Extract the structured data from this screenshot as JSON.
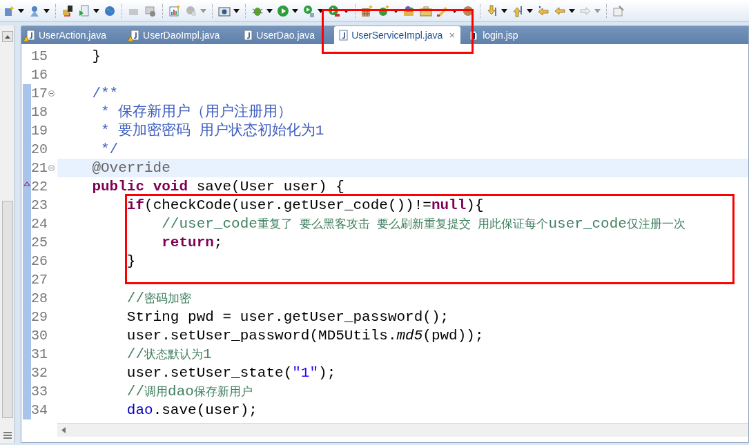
{
  "tabs": [
    {
      "label": "UserAction.java",
      "selected": false,
      "warning": true,
      "kind": "java"
    },
    {
      "label": "UserDaoImpl.java",
      "selected": false,
      "warning": true,
      "kind": "java"
    },
    {
      "label": "UserDao.java",
      "selected": false,
      "warning": false,
      "kind": "java"
    },
    {
      "label": "UserServiceImpl.java",
      "selected": true,
      "warning": false,
      "kind": "java",
      "close": "×"
    },
    {
      "label": "login.jsp",
      "selected": false,
      "warning": false,
      "kind": "jsp"
    }
  ],
  "editor": {
    "lines": [
      {
        "number": "15",
        "fold": false,
        "changed": false,
        "current": false,
        "override": false,
        "tokens": [
          {
            "kind": "plain",
            "text": "    }"
          }
        ]
      },
      {
        "number": "16",
        "fold": false,
        "changed": false,
        "current": false,
        "override": false
      },
      {
        "number": "17",
        "fold": true,
        "changed": true,
        "current": false,
        "override": false,
        "tokens": [
          {
            "kind": "doc",
            "text": "    /**"
          }
        ]
      },
      {
        "number": "18",
        "fold": false,
        "changed": true,
        "current": false,
        "override": false,
        "tokens": [
          {
            "kind": "doc",
            "text": "     * 保存新用户（用户注册用）"
          }
        ]
      },
      {
        "number": "19",
        "fold": false,
        "changed": true,
        "current": false,
        "override": false,
        "tokens": [
          {
            "kind": "doc",
            "text": "     * 要加密密码 用户状态初始化为1"
          }
        ]
      },
      {
        "number": "20",
        "fold": false,
        "changed": true,
        "current": false,
        "override": false,
        "tokens": [
          {
            "kind": "doc",
            "text": "     */"
          }
        ]
      },
      {
        "number": "21",
        "fold": true,
        "changed": true,
        "current": true,
        "override": false,
        "tokens": [
          {
            "kind": "annotation",
            "text": "    @Override"
          }
        ]
      },
      {
        "number": "22",
        "fold": false,
        "changed": true,
        "current": false,
        "override": true,
        "tokens": [
          {
            "kind": "keyword",
            "text": "    public"
          },
          {
            "kind": "keyword",
            "text": " void"
          },
          {
            "kind": "plain",
            "text": " save(User user) {"
          }
        ]
      },
      {
        "number": "23",
        "fold": false,
        "changed": true,
        "current": false,
        "override": false,
        "tokens": [
          {
            "kind": "keyword",
            "text": "        if"
          },
          {
            "kind": "plain",
            "text": "(checkCode(user.getUser_code())!="
          },
          {
            "kind": "keyword",
            "text": "null"
          },
          {
            "kind": "plain",
            "text": "){"
          }
        ]
      },
      {
        "number": "24",
        "fold": false,
        "changed": true,
        "current": false,
        "override": false,
        "tokens": [
          {
            "kind": "comment",
            "text": "            //user_code"
          },
          {
            "kind": "comment-cjk",
            "text": "重复了 要么黑客攻击 要么刷新重复提交 用此保证每个"
          },
          {
            "kind": "comment",
            "text": "user_code"
          },
          {
            "kind": "comment-cjk",
            "text": "仅注册一次"
          }
        ]
      },
      {
        "number": "25",
        "fold": false,
        "changed": true,
        "current": false,
        "override": false,
        "tokens": [
          {
            "kind": "keyword",
            "text": "            return"
          },
          {
            "kind": "plain",
            "text": ";"
          }
        ]
      },
      {
        "number": "26",
        "fold": false,
        "changed": true,
        "current": false,
        "override": false,
        "tokens": [
          {
            "kind": "plain",
            "text": "        }"
          }
        ]
      },
      {
        "number": "27",
        "fold": false,
        "changed": true,
        "current": false,
        "override": false
      },
      {
        "number": "28",
        "fold": false,
        "changed": true,
        "current": false,
        "override": false,
        "tokens": [
          {
            "kind": "comment",
            "text": "        //"
          },
          {
            "kind": "comment-cjk",
            "text": "密码加密"
          }
        ]
      },
      {
        "number": "29",
        "fold": false,
        "changed": true,
        "current": false,
        "override": false,
        "tokens": [
          {
            "kind": "plain",
            "text": "        String pwd = user.getUser_password();"
          }
        ]
      },
      {
        "number": "30",
        "fold": false,
        "changed": true,
        "current": false,
        "override": false,
        "tokens": [
          {
            "kind": "plain",
            "text": "        user.setUser_password(MD5Utils."
          },
          {
            "kind": "italic",
            "text": "md5"
          },
          {
            "kind": "plain",
            "text": "(pwd));"
          }
        ]
      },
      {
        "number": "31",
        "fold": false,
        "changed": true,
        "current": false,
        "override": false,
        "tokens": [
          {
            "kind": "comment",
            "text": "        //"
          },
          {
            "kind": "comment-cjk",
            "text": "状态默认为"
          },
          {
            "kind": "comment",
            "text": "1"
          }
        ]
      },
      {
        "number": "32",
        "fold": false,
        "changed": true,
        "current": false,
        "override": false,
        "tokens": [
          {
            "kind": "plain",
            "text": "        user.setUser_state("
          },
          {
            "kind": "string",
            "text": "\"1\""
          },
          {
            "kind": "plain",
            "text": ");"
          }
        ]
      },
      {
        "number": "33",
        "fold": false,
        "changed": true,
        "current": false,
        "override": false,
        "tokens": [
          {
            "kind": "comment",
            "text": "        //"
          },
          {
            "kind": "comment-cjk",
            "text": "调用"
          },
          {
            "kind": "comment",
            "text": "dao"
          },
          {
            "kind": "comment-cjk",
            "text": "保存新用户"
          }
        ]
      },
      {
        "number": "34",
        "fold": false,
        "changed": true,
        "current": false,
        "override": false,
        "tokens": [
          {
            "kind": "field",
            "text": "        dao"
          },
          {
            "kind": "plain",
            "text": ".save(user);"
          }
        ]
      }
    ]
  }
}
